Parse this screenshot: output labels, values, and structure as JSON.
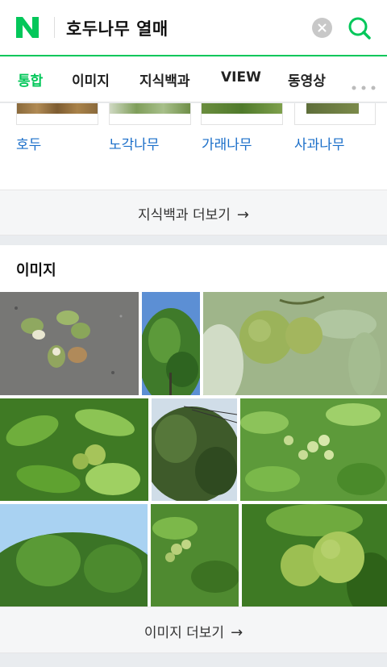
{
  "search": {
    "logo_letter": "N",
    "query": "호두나무 열매",
    "accent_color": "#03c75a",
    "icons": [
      "naver-logo-icon",
      "clear-icon",
      "search-icon"
    ]
  },
  "tabs": [
    {
      "label": "통합",
      "active": true
    },
    {
      "label": "이미지",
      "active": false
    },
    {
      "label": "지식백과",
      "active": false
    },
    {
      "label": "VIEW",
      "active": false
    },
    {
      "label": "동영상",
      "active": false
    }
  ],
  "related": {
    "items": [
      {
        "label": "호두"
      },
      {
        "label": "노각나무"
      },
      {
        "label": "가래나무"
      },
      {
        "label": "사과나무"
      }
    ],
    "more_label": "지식백과 더보기",
    "arrow": "→"
  },
  "images": {
    "title": "이미지",
    "more_label": "이미지 더보기",
    "arrow": "→",
    "photos": [
      "walnut-husks-on-asphalt",
      "walnut-tree-top",
      "green-walnuts-closeup",
      "walnut-leaves-with-fruit",
      "walnut-tree-and-wires",
      "walnut-fruit-cluster",
      "walnut-tree-canopy",
      "walnut-branch-fruits",
      "two-green-walnuts"
    ]
  }
}
